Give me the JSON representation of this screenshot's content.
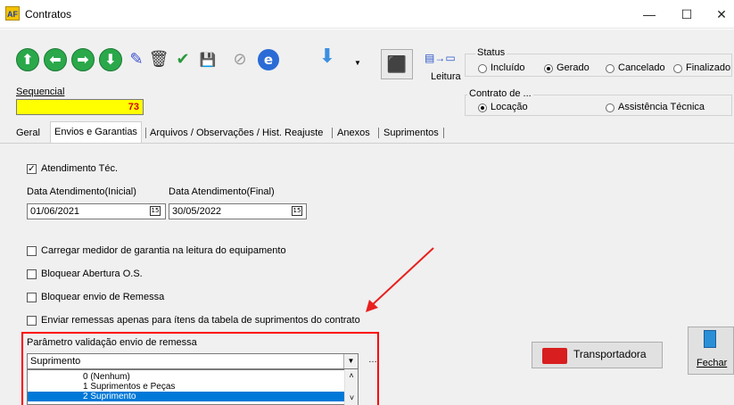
{
  "window": {
    "title": "Contratos",
    "app_icon_text": "AF",
    "controls": {
      "minimize": "—",
      "maximize": "☐",
      "close": "✕"
    }
  },
  "toolbar": {
    "buttons": [
      {
        "name": "up-arrow-icon",
        "glyph": "⬆"
      },
      {
        "name": "left-arrow-icon",
        "glyph": "⬅"
      },
      {
        "name": "right-arrow-icon",
        "glyph": "➡"
      },
      {
        "name": "down-arrow-icon",
        "glyph": "⬇"
      },
      {
        "name": "edit-pencil-icon",
        "glyph": "✎"
      },
      {
        "name": "trash-icon",
        "glyph": "🗑"
      },
      {
        "name": "confirm-check-icon",
        "glyph": "✔"
      },
      {
        "name": "save-disk-icon",
        "glyph": "💾"
      },
      {
        "name": "cancel-icon",
        "glyph": "⊘"
      },
      {
        "name": "browser-icon",
        "glyph": "e"
      },
      {
        "name": "dropdown-arrow-icon",
        "glyph": "⬇"
      }
    ],
    "leitura_label": "Leitura",
    "big_button_glyph": "⬛"
  },
  "status_group": {
    "title": "Status",
    "options": [
      {
        "label": "Incluído",
        "selected": false
      },
      {
        "label": "Gerado",
        "selected": true
      },
      {
        "label": "Cancelado",
        "selected": false
      },
      {
        "label": "Finalizado",
        "selected": false
      }
    ]
  },
  "contrato_group": {
    "title": "Contrato de ...",
    "options": [
      {
        "label": "Locação",
        "selected": true
      },
      {
        "label": "Assistência Técnica",
        "selected": false
      }
    ]
  },
  "sequencial": {
    "label": "Sequencial",
    "value": "73"
  },
  "tabs": [
    {
      "label": "Geral",
      "active": false
    },
    {
      "label": "Envios e Garantias",
      "active": true
    },
    {
      "label": "Arquivos / Observações / Hist. Reajuste",
      "active": false
    },
    {
      "label": "Anexos",
      "active": false
    },
    {
      "label": "Suprimentos",
      "active": false
    }
  ],
  "envios": {
    "atendimento_tec": {
      "label": "Atendimento Téc.",
      "checked": true
    },
    "data_inicial": {
      "label": "Data Atendimento(Inicial)",
      "value": "01/06/2021"
    },
    "data_final": {
      "label": "Data Atendimento(Final)",
      "value": "30/05/2022"
    },
    "calendar_glyph": "15",
    "checkboxes": [
      {
        "label": "Carregar medidor de garantia na leitura do equipamento",
        "checked": false
      },
      {
        "label": "Bloquear Abertura O.S.",
        "checked": false
      },
      {
        "label": "Bloquear envio de Remessa",
        "checked": false
      },
      {
        "label": "Enviar remessas apenas para ítens da tabela de suprimentos do contrato",
        "checked": false
      }
    ],
    "parametro": {
      "label": "Parâmetro validação envio de remessa",
      "selected_value": "Suprimento",
      "options": [
        {
          "label": "0  (Nenhum)",
          "highlighted": false
        },
        {
          "label": "1  Suprimentos e Peças",
          "highlighted": false
        },
        {
          "label": "2  Suprimento",
          "highlighted": true
        }
      ]
    }
  },
  "actions": {
    "transportadora": "Transportadora",
    "fechar": "Fechar"
  },
  "annotation": {
    "arrow_color": "#e8201e",
    "box_color": "#ff0000"
  }
}
